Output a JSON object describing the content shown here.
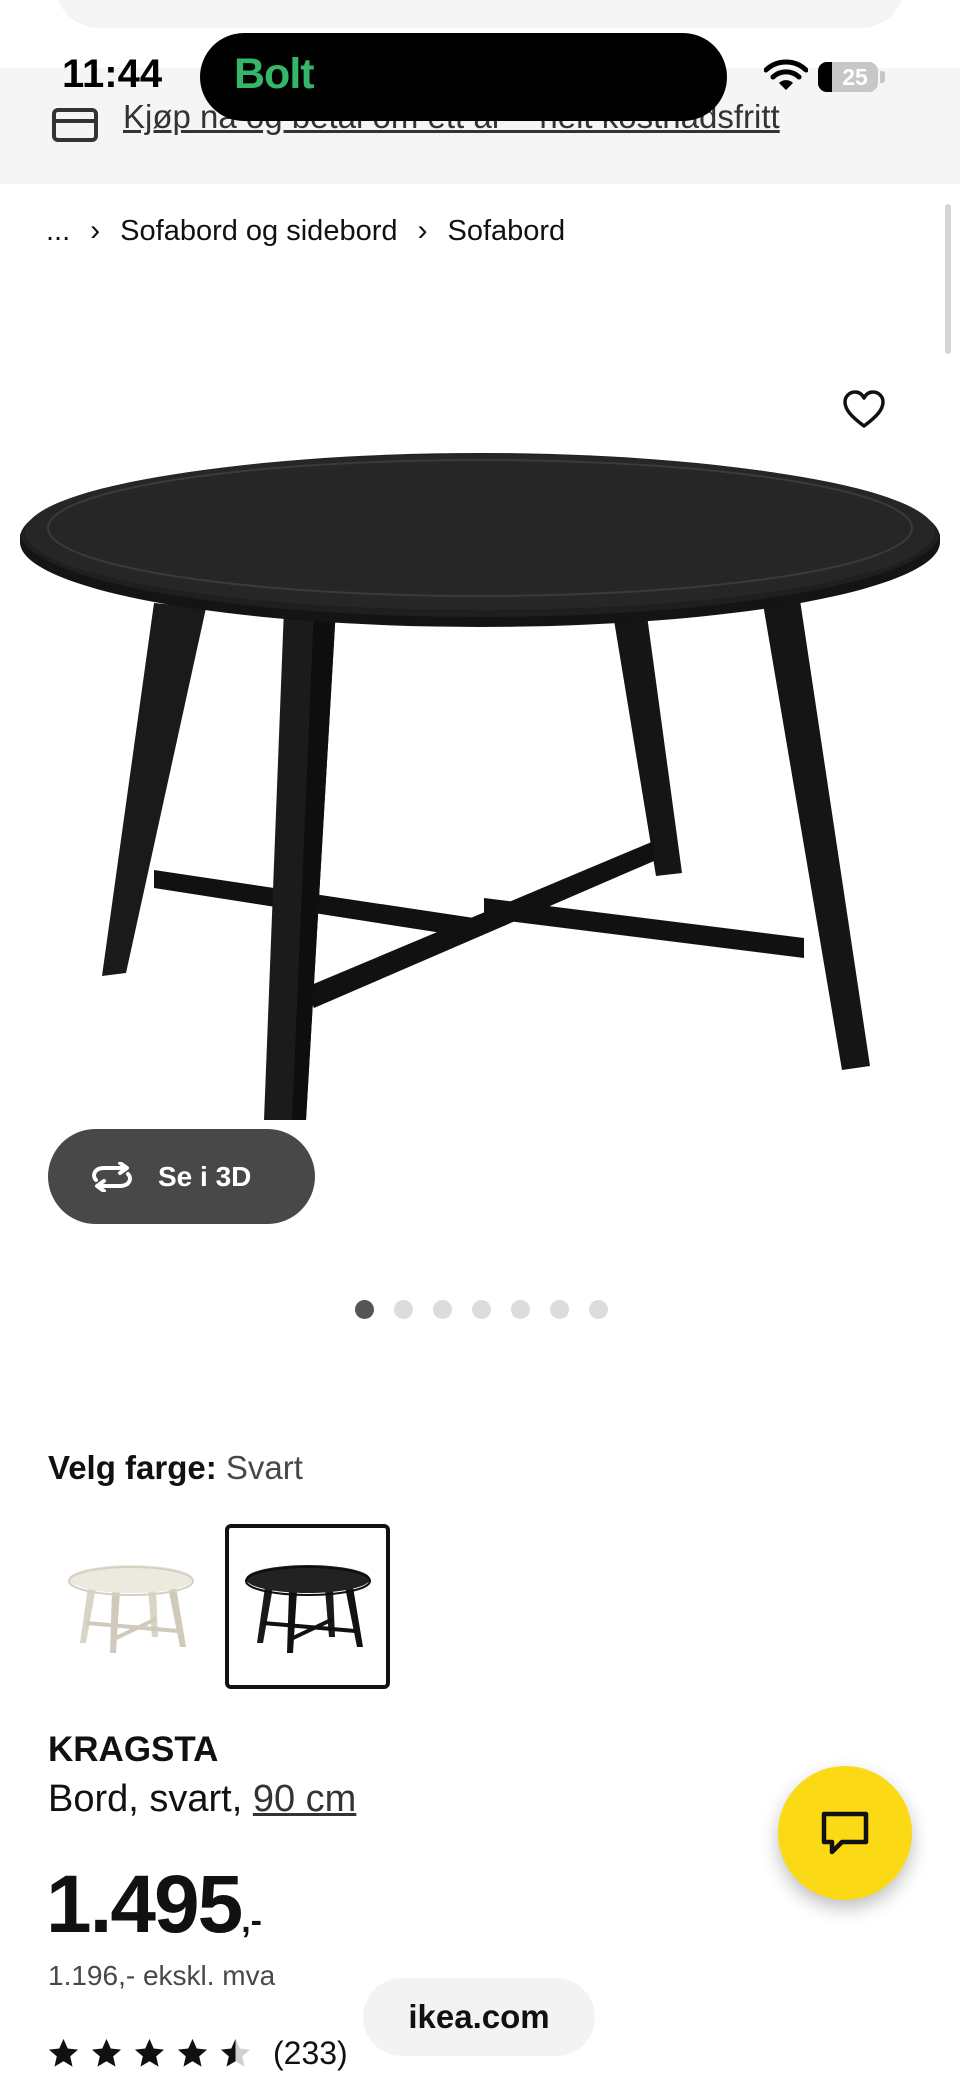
{
  "status_bar": {
    "time": "11:44",
    "island_app": "Bolt",
    "battery_level": "25",
    "icons": [
      "wifi-icon",
      "battery-icon"
    ]
  },
  "promo": {
    "text": "Kjøp nå og betal om ett år – helt kostnadsfritt",
    "icon": "card-icon"
  },
  "breadcrumb": {
    "ellipsis": "...",
    "separator": "›",
    "items": [
      "Sofabord og sidebord",
      "Sofabord"
    ]
  },
  "gallery": {
    "favorite_icon": "heart-icon",
    "view_3d_label": "Se i 3D",
    "view_3d_icon": "rotate-icon",
    "dots_total": 7,
    "dots_active_index": 0
  },
  "color_picker": {
    "label": "Velg farge:",
    "selected": "Svart",
    "options": [
      "white",
      "black"
    ],
    "colors": {
      "white": "#ece9df",
      "black": "#1a1a1a"
    }
  },
  "product": {
    "name": "KRAGSTA",
    "description": "Bord, svart,",
    "size_link": "90 cm",
    "price": "1.495",
    "price_suffix": ",-",
    "price_ex_vat": "1.196,- ekskl. mva",
    "rating": 4.5,
    "review_count": "(233)"
  },
  "chat": {
    "icon": "chat-icon",
    "color": "#fbd914"
  },
  "browser": {
    "url": "ikea.com"
  }
}
